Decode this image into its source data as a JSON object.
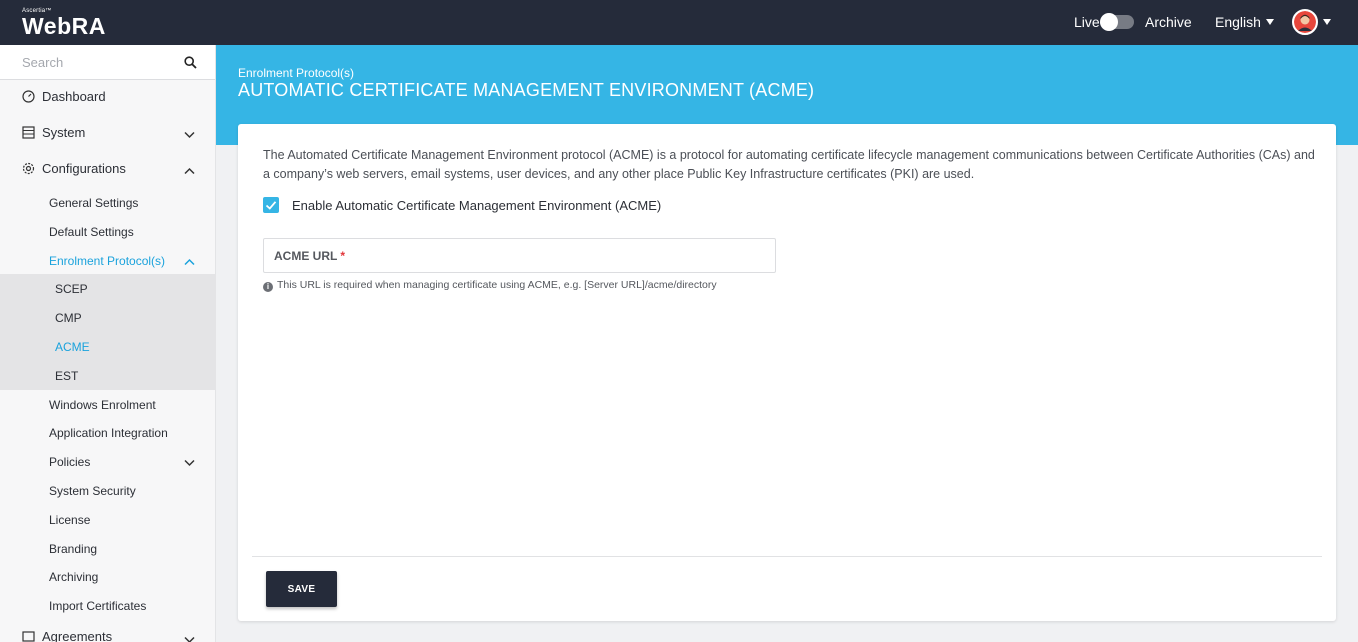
{
  "header": {
    "brand_small": "Ascertia™",
    "brand": "WebRA",
    "live_label": "Live",
    "archive_label": "Archive",
    "language": "English"
  },
  "sidebar": {
    "search_placeholder": "Search",
    "items": [
      {
        "label": "Dashboard",
        "icon": "dashboard-icon"
      },
      {
        "label": "System",
        "icon": "system-icon"
      },
      {
        "label": "Configurations",
        "icon": "gear-icon"
      }
    ],
    "config_sub": [
      {
        "label": "General Settings"
      },
      {
        "label": "Default Settings"
      },
      {
        "label": "Enrolment Protocol(s)"
      },
      {
        "label": "Windows Enrolment"
      },
      {
        "label": "Application Integration"
      },
      {
        "label": "Policies"
      },
      {
        "label": "System Security"
      },
      {
        "label": "License"
      },
      {
        "label": "Branding"
      },
      {
        "label": "Archiving"
      },
      {
        "label": "Import Certificates"
      }
    ],
    "protocols": [
      {
        "label": "SCEP"
      },
      {
        "label": "CMP"
      },
      {
        "label": "ACME"
      },
      {
        "label": "EST"
      }
    ],
    "partial_item": "Agreements"
  },
  "page": {
    "breadcrumb": "Enrolment Protocol(s)",
    "title": "AUTOMATIC CERTIFICATE MANAGEMENT ENVIRONMENT (ACME)",
    "description": "The Automated Certificate Management Environment protocol (ACME) is a protocol for automating certificate lifecycle management communications between Certificate Authorities (CAs) and a company’s web servers, email systems, user devices, and any other place Public Key Infrastructure certificates (PKI) are used.",
    "checkbox_label": "Enable Automatic Certificate Management Environment (ACME)",
    "checkbox_checked": true,
    "acme_url_label": "ACME URL",
    "acme_url_required": "*",
    "acme_url_value": "",
    "hint": "This URL is required when managing certificate using ACME, e.g. [Server URL]/acme/directory",
    "save_label": "SAVE"
  },
  "colors": {
    "topbar": "#252b3a",
    "accent": "#35b5e5",
    "active_link": "#1aa2dc",
    "required": "#e2373b"
  }
}
